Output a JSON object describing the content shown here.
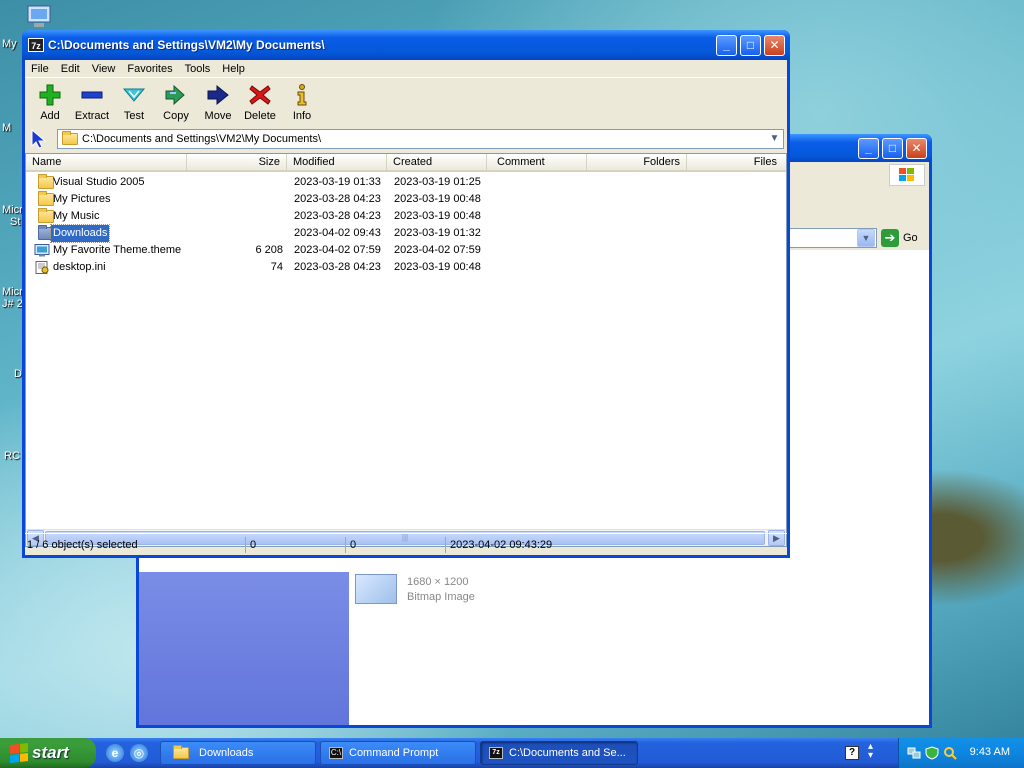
{
  "desktop": {
    "labels": [
      "My",
      "M",
      "Micro",
      "St",
      "Micro",
      "J# 2",
      "D",
      "RC"
    ]
  },
  "background_window": {
    "go_label": "Go",
    "file_subtitle": "Bitmap Image",
    "file_partial": "1680 × 1200"
  },
  "window": {
    "title": "C:\\Documents and Settings\\VM2\\My Documents\\",
    "title_icon": "7z"
  },
  "menu": [
    "File",
    "Edit",
    "View",
    "Favorites",
    "Tools",
    "Help"
  ],
  "toolbar": [
    {
      "label": "Add",
      "icon": "plus-icon",
      "color": "#1e9e1e"
    },
    {
      "label": "Extract",
      "icon": "minus-icon",
      "color": "#1b3cc7"
    },
    {
      "label": "Test",
      "icon": "check-arrow-icon",
      "color": "#2ab0c8"
    },
    {
      "label": "Copy",
      "icon": "double-arrow-icon",
      "color": "#2e9a5a"
    },
    {
      "label": "Move",
      "icon": "arrow-right-icon",
      "color": "#1a2a8a"
    },
    {
      "label": "Delete",
      "icon": "x-icon",
      "color": "#d01818"
    },
    {
      "label": "Info",
      "icon": "info-icon",
      "color": "#c8a020"
    }
  ],
  "address": {
    "value": "C:\\Documents and Settings\\VM2\\My Documents\\"
  },
  "columns": [
    "Name",
    "Size",
    "Modified",
    "Created",
    "Comment",
    "Folders",
    "Files"
  ],
  "files": [
    {
      "name": "Visual Studio 2005",
      "size": "",
      "modified": "2023-03-19 01:33",
      "created": "2023-03-19 01:25",
      "type": "folder"
    },
    {
      "name": "My Pictures",
      "size": "",
      "modified": "2023-03-28 04:23",
      "created": "2023-03-19 00:48",
      "type": "folder"
    },
    {
      "name": "My Music",
      "size": "",
      "modified": "2023-03-28 04:23",
      "created": "2023-03-19 00:48",
      "type": "folder"
    },
    {
      "name": "Downloads",
      "size": "",
      "modified": "2023-04-02 09:43",
      "created": "2023-03-19 01:32",
      "type": "folder",
      "selected": true
    },
    {
      "name": "My Favorite Theme.theme",
      "size": "6 208",
      "modified": "2023-04-02 07:59",
      "created": "2023-04-02 07:59",
      "type": "theme"
    },
    {
      "name": "desktop.ini",
      "size": "74",
      "modified": "2023-03-28 04:23",
      "created": "2023-03-19 00:48",
      "type": "ini"
    }
  ],
  "status": {
    "selection": "1 / 6 object(s) selected",
    "size": "0",
    "packed": "0",
    "modified": "2023-04-02 09:43:29"
  },
  "taskbar": {
    "start": "start",
    "tasks": [
      {
        "label": "Downloads",
        "icon": "folder-icon"
      },
      {
        "label": "Command Prompt",
        "icon": "cmd-icon"
      },
      {
        "label": "C:\\Documents and Se...",
        "icon": "7zip-icon"
      }
    ],
    "time": "9:43 AM"
  }
}
